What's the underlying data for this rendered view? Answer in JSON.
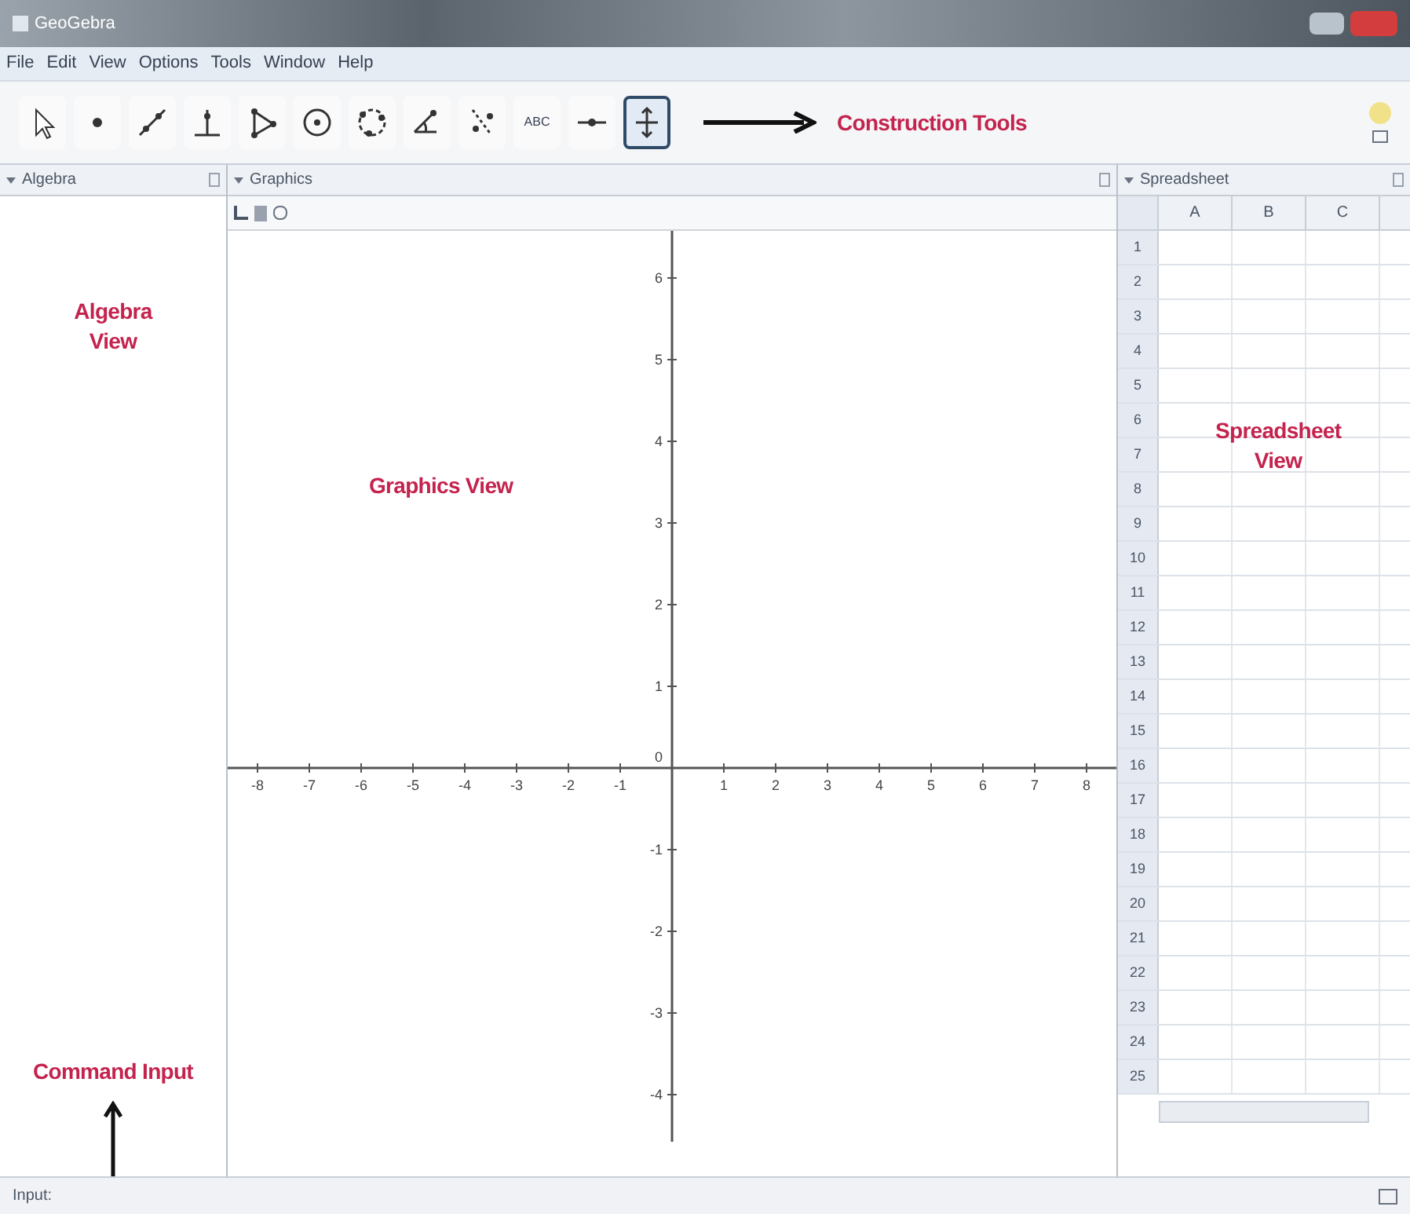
{
  "window": {
    "title": "GeoGebra"
  },
  "menu": [
    "File",
    "Edit",
    "View",
    "Options",
    "Tools",
    "Window",
    "Help"
  ],
  "toolbar": {
    "tools": [
      {
        "kind": "move",
        "selected": false
      },
      {
        "kind": "point",
        "selected": false
      },
      {
        "kind": "line",
        "selected": false
      },
      {
        "kind": "perpendicular",
        "selected": false
      },
      {
        "kind": "polygon",
        "selected": false
      },
      {
        "kind": "circle",
        "selected": false
      },
      {
        "kind": "circle3",
        "selected": false
      },
      {
        "kind": "angle",
        "selected": false
      },
      {
        "kind": "reflect",
        "selected": false
      },
      {
        "kind": "text",
        "label": "ABC",
        "selected": false
      },
      {
        "kind": "slider",
        "selected": false
      },
      {
        "kind": "move_view",
        "selected": true
      }
    ],
    "annotation": "Construction Tools"
  },
  "algebra_view": {
    "title": "Algebra",
    "annotation": "Algebra View"
  },
  "graphics_view": {
    "title": "Graphics",
    "annotation": "Graphics View",
    "x_labels": [
      "-8",
      "-7",
      "-6",
      "-5",
      "-4",
      "-3",
      "-2",
      "-1",
      "1",
      "2",
      "3",
      "4",
      "5",
      "6",
      "7",
      "8"
    ],
    "y_labels": [
      "6",
      "5",
      "4",
      "3",
      "2",
      "1",
      "-1",
      "-2",
      "-3",
      "-4"
    ],
    "origin_label": "0"
  },
  "spreadsheet_view": {
    "title": "Spreadsheet",
    "annotation": "Spreadsheet View",
    "columns": [
      "A",
      "B",
      "C"
    ],
    "rows": [
      "1",
      "2",
      "3",
      "4",
      "5",
      "6",
      "7",
      "8",
      "9",
      "10",
      "11",
      "12",
      "13",
      "14",
      "15",
      "16",
      "17",
      "18",
      "19",
      "20",
      "21",
      "22",
      "23",
      "24",
      "25"
    ]
  },
  "input_bar": {
    "label": "Input:",
    "annotation": "Command Input"
  }
}
